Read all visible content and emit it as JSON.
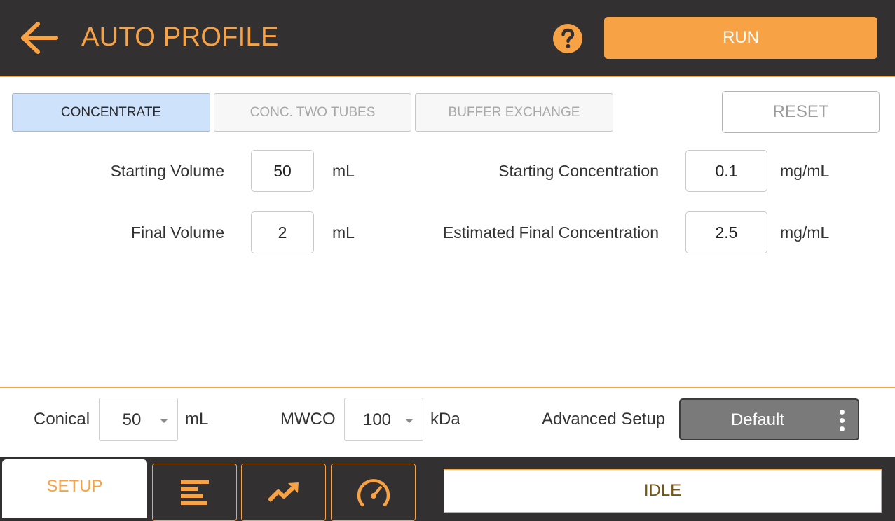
{
  "header": {
    "title": "AUTO PROFILE",
    "back_icon": "arrow-left-icon",
    "help_icon": "question-circle-icon",
    "run_label": "RUN"
  },
  "colors": {
    "accent": "#f7a245",
    "header_bg": "#333031",
    "active_tab_bg": "#cfe2fb",
    "advanced_button_bg": "#7a7a7a",
    "status_text": "#7a5412"
  },
  "modes": {
    "tabs": [
      {
        "label": "CONCENTRATE",
        "active": true
      },
      {
        "label": "CONC. TWO TUBES",
        "active": false
      },
      {
        "label": "BUFFER EXCHANGE",
        "active": false
      }
    ],
    "reset_label": "RESET"
  },
  "form": {
    "starting_volume": {
      "label": "Starting Volume",
      "value": "50",
      "unit": "mL"
    },
    "final_volume": {
      "label": "Final Volume",
      "value": "2",
      "unit": "mL"
    },
    "starting_concentration": {
      "label": "Starting Concentration",
      "value": "0.1",
      "unit": "mg/mL"
    },
    "final_concentration": {
      "label": "Estimated Final Concentration",
      "value": "2.5",
      "unit": "mg/mL"
    }
  },
  "setup": {
    "conical": {
      "label": "Conical",
      "value": "50",
      "unit": "mL"
    },
    "mwco": {
      "label": "MWCO",
      "value": "100",
      "unit": "kDa"
    },
    "advanced": {
      "label": "Advanced Setup",
      "button_label": "Default",
      "menu_icon": "kebab-menu-icon"
    }
  },
  "footer": {
    "setup_tab_label": "SETUP",
    "nav_icons": [
      "profile-bars-icon",
      "trend-chart-icon",
      "speedometer-icon"
    ],
    "status": "IDLE"
  }
}
